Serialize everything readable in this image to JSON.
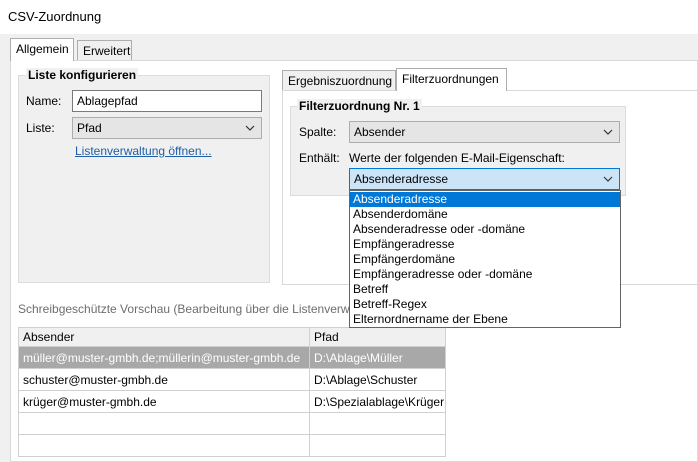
{
  "window": {
    "title": "CSV-Zuordnung"
  },
  "main_tabs": [
    {
      "label": "Allgemein",
      "active": true
    },
    {
      "label": "Erweitert",
      "active": false
    }
  ],
  "list_config": {
    "title": "Liste konfigurieren",
    "name_label": "Name:",
    "name_value": "Ablagepfad",
    "list_label": "Liste:",
    "list_value": "Pfad",
    "manage_link": "Listenverwaltung öffnen..."
  },
  "right_tabs": [
    {
      "label": "Ergebniszuordnung",
      "active": false
    },
    {
      "label": "Filterzuordnungen",
      "active": true
    }
  ],
  "filter": {
    "title": "Filterzuordnung Nr. 1",
    "column_label": "Spalte:",
    "column_value": "Absender",
    "contains_label": "Enthält:",
    "contains_desc": "Werte der folgenden E-Mail-Eigenschaft:",
    "property_value": "Absenderadresse",
    "options": [
      "Absenderadresse",
      "Absenderdomäne",
      "Absenderadresse oder -domäne",
      "Empfängeradresse",
      "Empfängerdomäne",
      "Empfängeradresse oder -domäne",
      "Betreff",
      "Betreff-Regex",
      "Elternordnername der Ebene"
    ],
    "selected_index": 0
  },
  "preview": {
    "label": "Schreibgeschützte Vorschau (Bearbeitung über die Listenverwal",
    "columns": [
      "Absender",
      "Pfad"
    ],
    "rows": [
      [
        "müller@muster-gmbh.de;müllerin@muster-gmbh.de",
        "D:\\Ablage\\Müller"
      ],
      [
        "schuster@muster-gmbh.de",
        "D:\\Ablage\\Schuster"
      ],
      [
        "krüger@muster-gmbh.de",
        "D:\\Spezialablage\\Krüger"
      ],
      [
        "",
        ""
      ],
      [
        "",
        ""
      ]
    ],
    "selected_row": 0
  },
  "colors": {
    "selection": "#0078d7",
    "link": "#1f5fa8",
    "row_selected": "#a8a8a8"
  }
}
